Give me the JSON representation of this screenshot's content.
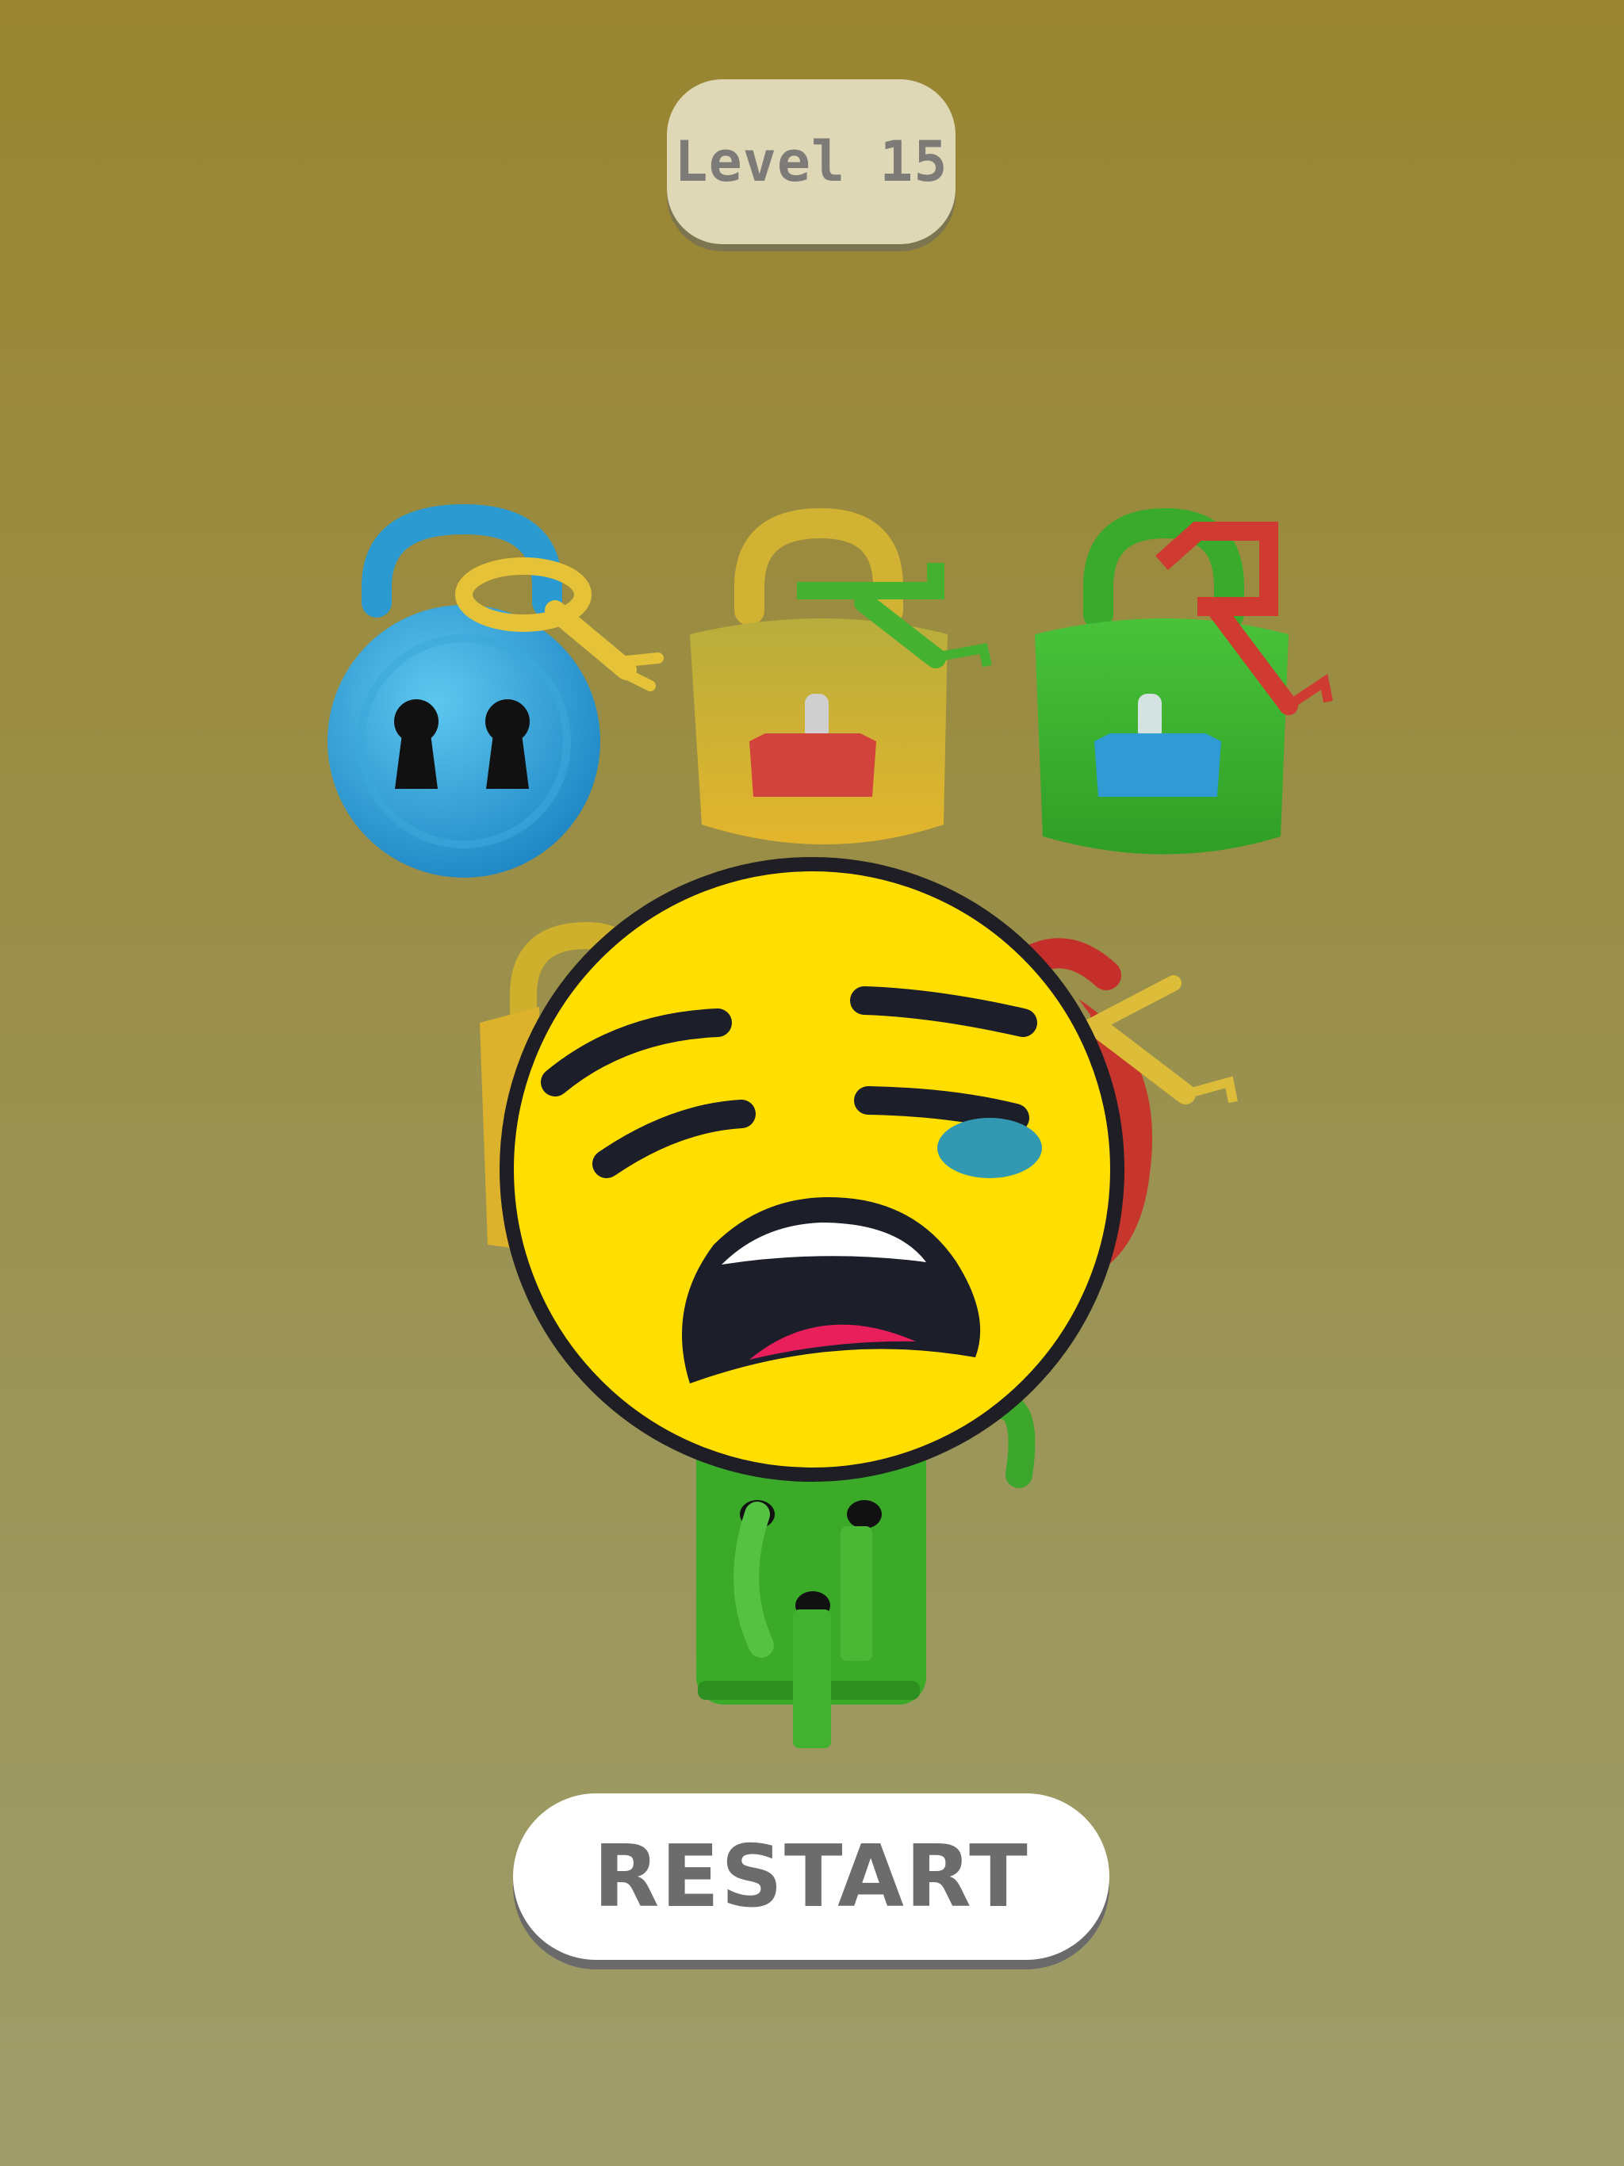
{
  "hud": {
    "level_label": "Level 15"
  },
  "actions": {
    "restart_label": "RESTART"
  },
  "result": {
    "emoji": "crying-face-emoji"
  },
  "colors": {
    "background_top": "#998530",
    "background_bottom": "#9e9c6a",
    "blue_lock": "#2aa0d8",
    "yellow_lock": "#e0c23a",
    "green_lock": "#3fb52f",
    "red_lock": "#c8332d",
    "emoji_yellow": "#ffdf00",
    "tear_blue": "#3399b3"
  }
}
